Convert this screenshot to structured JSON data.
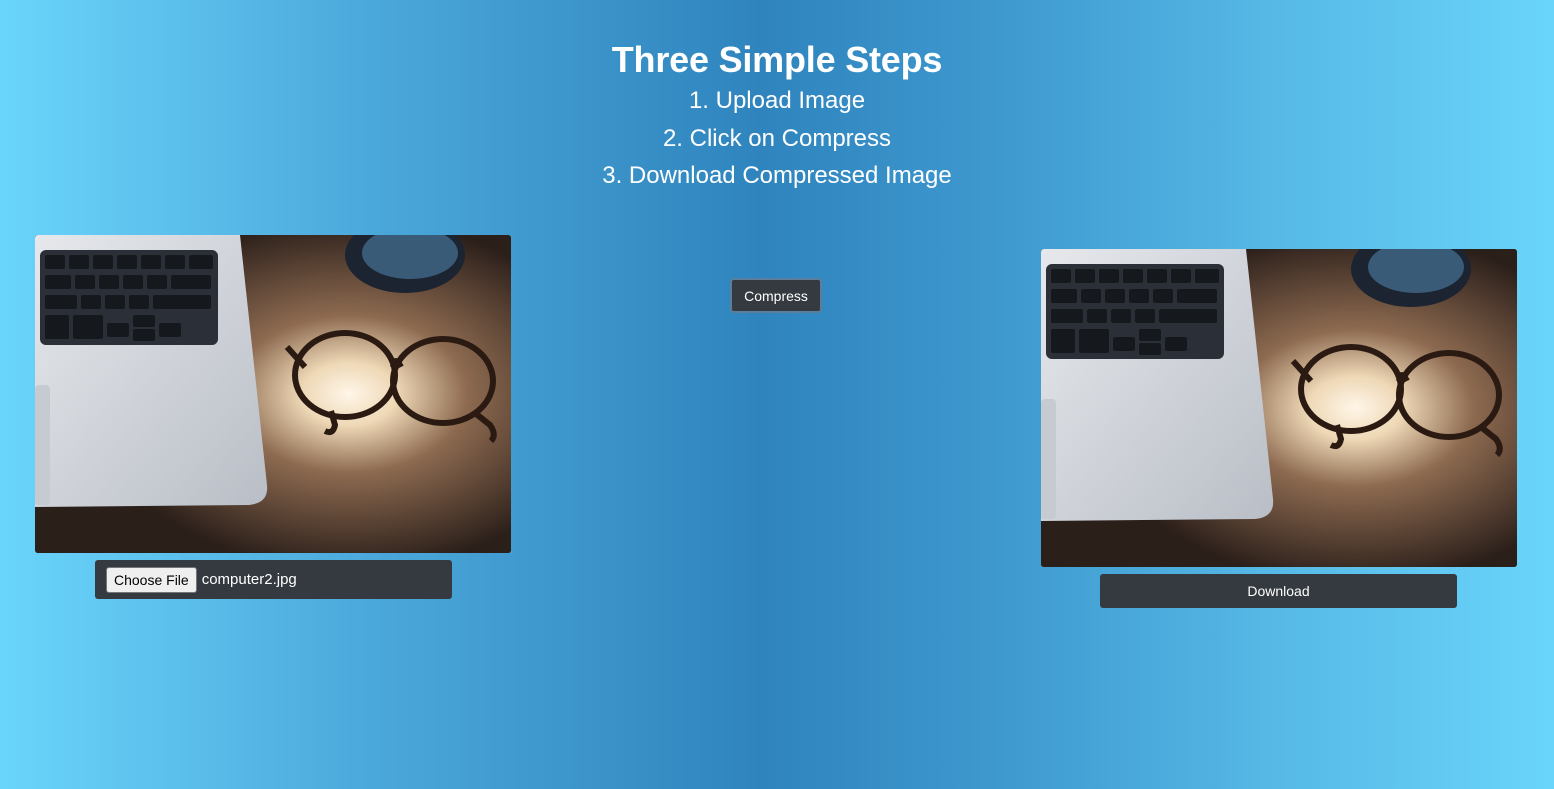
{
  "header": {
    "title": "Three Simple Steps",
    "steps": [
      "1. Upload Image",
      "2. Click on Compress",
      "3. Download Compressed Image"
    ]
  },
  "upload": {
    "choose_label": "Choose File",
    "file_name": "computer2.jpg"
  },
  "actions": {
    "compress_label": "Compress",
    "download_label": "Download"
  },
  "images": {
    "original": "laptop-and-glasses-photo",
    "compressed": "laptop-and-glasses-photo"
  },
  "colors": {
    "background_edge": "#6ad5fb",
    "background_center": "#2f84bd",
    "button_dark": "#343a40",
    "text": "#ffffff"
  }
}
